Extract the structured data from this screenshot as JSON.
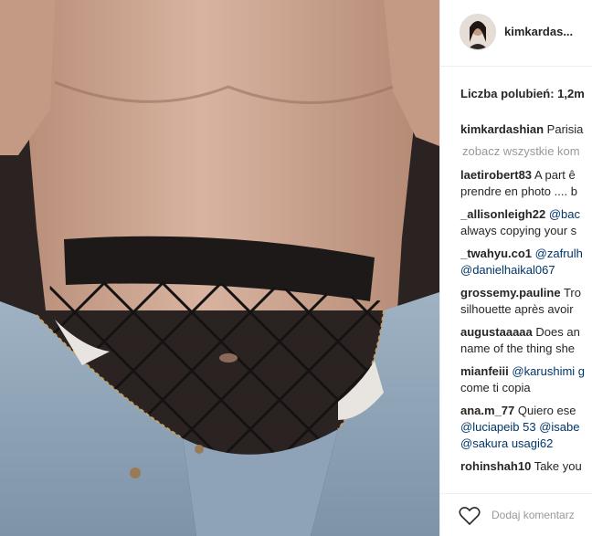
{
  "post": {
    "username": "kimkardas...",
    "likes": "Liczba polubień: 1,2m",
    "view_all": "zobacz wszystkie kom",
    "add_comment": "Dodaj komentarz"
  },
  "comments": [
    {
      "user": "kimkardashian",
      "lines": [
        [
          "Parisia"
        ]
      ]
    },
    {
      "user": "laetirobert83",
      "lines": [
        [
          "A part ê"
        ],
        [
          "prendre en photo .... b"
        ]
      ]
    },
    {
      "user": "_allisonleigh22",
      "lines": [
        [
          "@bac"
        ],
        [
          "always copying your s"
        ]
      ]
    },
    {
      "user": "_twahyu.co1",
      "lines": [
        [
          "@zafrulh"
        ],
        [
          "@danielhaikal067"
        ]
      ]
    },
    {
      "user": "grossemy.pauline",
      "lines": [
        [
          "Tro"
        ],
        [
          "silhouette après avoir "
        ]
      ]
    },
    {
      "user": "augustaaaaa",
      "lines": [
        [
          "Does an"
        ],
        [
          "name of the thing she "
        ]
      ]
    },
    {
      "user": "mianfeiii",
      "lines": [
        [
          "@karushimi g"
        ],
        [
          "come ti copia"
        ]
      ]
    },
    {
      "user": "ana.m_77",
      "lines": [
        [
          "Quiero ese"
        ],
        [
          "@luciapeib  53  @isabe"
        ],
        [
          "@sakura  usagi62"
        ]
      ]
    },
    {
      "user": "rohinshah10",
      "lines": [
        [
          "Take you"
        ]
      ]
    }
  ],
  "colors": {
    "link": "#003569",
    "muted": "#999999",
    "text": "#262626",
    "border": "#efefef"
  }
}
